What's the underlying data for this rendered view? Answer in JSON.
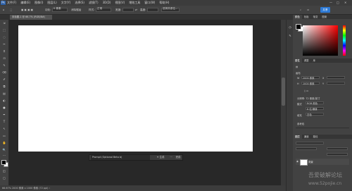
{
  "app": {
    "logo": "Ps"
  },
  "menubar": {
    "items": [
      "文件(F)",
      "编辑(E)",
      "图像(I)",
      "图层(L)",
      "文字(Y)",
      "选择(S)",
      "滤镜(T)",
      "3D(D)",
      "视图(V)",
      "增效工具",
      "窗口(W)",
      "帮助(H)"
    ],
    "window_controls": [
      "—",
      "□",
      "✕"
    ]
  },
  "optionsbar": {
    "feather_label": "羽化:",
    "feather_value": "0 像素",
    "antialias_label": "消除锯齿",
    "style_label": "样式:",
    "style_value": "正常",
    "width_label": "宽度:",
    "height_label": "高度:",
    "select_mask_label": "选择并遮住...",
    "share_label": "共享"
  },
  "document": {
    "tab_title": "未标题-1 @ 66.7% (RGB/8#)"
  },
  "tools": [
    "⇲",
    "⬚",
    "◌",
    "✂",
    "⌗",
    "⊡",
    "✎",
    "⌫",
    "✐",
    "⧉",
    "▤",
    "◐",
    "●",
    "✒",
    "T",
    "↖",
    "▭",
    "✋",
    "🔍",
    "···"
  ],
  "context_bar": {
    "prompt_placeholder": "Prompt (Optional Beta b)",
    "generate_label": "✦ 生成",
    "more_label": "···",
    "done_label": "完成"
  },
  "statusbar": {
    "text": "66.67%  2000 像素 x 1000 像素 (72 ppi)  ›"
  },
  "panels": {
    "color_tabs": [
      "颜色",
      "色板",
      "渐变",
      "图案"
    ],
    "properties_tabs": [
      "属性",
      "调整",
      "库"
    ],
    "properties": {
      "section_title": "画布",
      "w_label": "W",
      "w_value": "2000 像素",
      "h_label": "H",
      "h_value": "1000 像素",
      "x_label": "X",
      "y_label": "Y",
      "resolution_label": "分辨率: 72 像素/英寸",
      "mode_label": "模式",
      "mode_value": "RGB 颜色",
      "depth_value": "8 位/通道",
      "fill_label": "填充",
      "fill_value": "白色",
      "guides_label": "参考线"
    },
    "layers_tabs": [
      "图层",
      "通道",
      "路径"
    ],
    "layer_name": "背景"
  },
  "watermark": {
    "line1": "吾爱破解论坛",
    "line2": "www.52pojie.cn"
  },
  "colors": {
    "accent": "#2d7ad6",
    "canvas": "#ffffff",
    "workspace": "#282828"
  }
}
